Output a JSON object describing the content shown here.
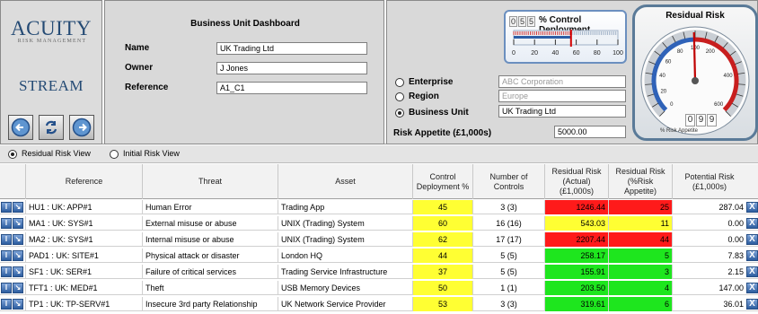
{
  "logo": {
    "brand": "ACUITY",
    "tagline": "RISK MANAGEMENT",
    "product": "STREAM"
  },
  "dashboard": {
    "title": "Business Unit Dashboard",
    "fields": [
      {
        "label": "Name",
        "value": "UK Trading Ltd"
      },
      {
        "label": "Owner",
        "value": "J Jones"
      },
      {
        "label": "Reference",
        "value": "A1_C1"
      }
    ]
  },
  "scope": {
    "options": [
      {
        "label": "Enterprise",
        "value": "ABC Corporation",
        "selected": false,
        "enabled": false
      },
      {
        "label": "Region",
        "value": "Europe",
        "selected": false,
        "enabled": false
      },
      {
        "label": "Business Unit",
        "value": "UK Trading Ltd",
        "selected": true,
        "enabled": true
      }
    ],
    "appetite_label": "Risk Appetite (£1,000s)",
    "appetite_value": "5000.00"
  },
  "control_gauge": {
    "digits": [
      "0",
      "5",
      "5"
    ],
    "title": "% Control Deployment",
    "ticks": [
      "0",
      "20",
      "40",
      "60",
      "80",
      "100"
    ],
    "value": 55
  },
  "risk_gauge": {
    "title": "Residual Risk",
    "ticks": [
      "0",
      "20",
      "40",
      "60",
      "80",
      "100",
      "200",
      "400",
      "600"
    ],
    "digits": [
      "0",
      "9",
      "9"
    ],
    "caption": "% Risk Appetite",
    "value": 99
  },
  "filter": {
    "options": [
      {
        "label": "Residual Risk View",
        "selected": true
      },
      {
        "label": "Initial Risk View",
        "selected": false
      }
    ]
  },
  "table": {
    "headers": [
      "Reference",
      "Threat",
      "Asset",
      "Control\nDeployment %",
      "Number of\nControls",
      "Residual Risk\n(Actual)\n(£1,000s)",
      "Residual Risk\n(%Risk\nAppetite)",
      "Potential Risk\n(£1,000s)"
    ],
    "rows": [
      {
        "ref": "HU1 : UK: APP#1",
        "threat": "Human Error",
        "asset": "Trading App",
        "deploy": "45",
        "controls": "3 (3)",
        "actual": "1246.44",
        "pct": "25",
        "potential": "287.04",
        "actual_color": "red",
        "pct_color": "red"
      },
      {
        "ref": "MA1 : UK: SYS#1",
        "threat": "External misuse or abuse",
        "asset": "UNIX (Trading) System",
        "deploy": "60",
        "controls": "16 (16)",
        "actual": "543.03",
        "pct": "11",
        "potential": "0.00",
        "actual_color": "yellow",
        "pct_color": "yellow"
      },
      {
        "ref": "MA2 : UK: SYS#1",
        "threat": "Internal misuse or abuse",
        "asset": "UNIX (Trading) System",
        "deploy": "62",
        "controls": "17 (17)",
        "actual": "2207.44",
        "pct": "44",
        "potential": "0.00",
        "actual_color": "red",
        "pct_color": "red"
      },
      {
        "ref": "PAD1 : UK: SITE#1",
        "threat": "Physical attack or disaster",
        "asset": "London HQ",
        "deploy": "44",
        "controls": "5 (5)",
        "actual": "258.17",
        "pct": "5",
        "potential": "7.83",
        "actual_color": "green",
        "pct_color": "green"
      },
      {
        "ref": "SF1 : UK: SER#1",
        "threat": "Failure of critical services",
        "asset": "Trading Service Infrastructure",
        "deploy": "37",
        "controls": "5 (5)",
        "actual": "155.91",
        "pct": "3",
        "potential": "2.15",
        "actual_color": "green",
        "pct_color": "green"
      },
      {
        "ref": "TFT1 : UK: MED#1",
        "threat": "Theft",
        "asset": "USB Memory Devices",
        "deploy": "50",
        "controls": "1 (1)",
        "actual": "203.50",
        "pct": "4",
        "potential": "147.00",
        "actual_color": "green",
        "pct_color": "green"
      },
      {
        "ref": "TP1 : UK: TP-SERV#1",
        "threat": "Insecure 3rd party Relationship",
        "asset": "UK Network Service Provider",
        "deploy": "53",
        "controls": "3 (3)",
        "actual": "319.61",
        "pct": "6",
        "potential": "36.01",
        "actual_color": "green",
        "pct_color": "green"
      }
    ]
  }
}
